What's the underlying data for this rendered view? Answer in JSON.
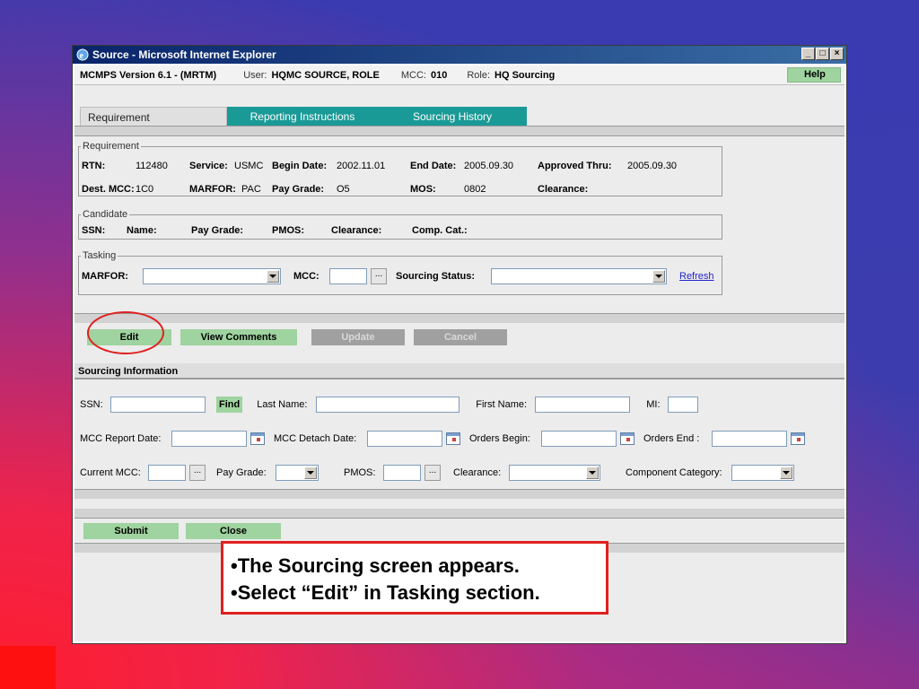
{
  "window": {
    "title": "Source - Microsoft Internet Explorer",
    "btn_min": "_",
    "btn_max": "□",
    "btn_close": "×"
  },
  "infobar": {
    "version": "MCMPS Version 6.1 - (MRTM)",
    "user_label": "User:",
    "user_value": "HQMC SOURCE, ROLE",
    "mcc_label": "MCC:",
    "mcc_value": "010",
    "role_label": "Role:",
    "role_value": "HQ Sourcing",
    "help": "Help"
  },
  "tabs": [
    {
      "label": "Requirement"
    },
    {
      "label": "Reporting Instructions"
    },
    {
      "label": "Sourcing History"
    }
  ],
  "requirement": {
    "legend": "Requirement",
    "rtn_label": "RTN:",
    "rtn_value": "112480",
    "service_label": "Service:",
    "service_value": "USMC",
    "begin_label": "Begin Date:",
    "begin_value": "2002.11.01",
    "end_label": "End Date:",
    "end_value": "2005.09.30",
    "approved_label": "Approved Thru:",
    "approved_value": "2005.09.30",
    "dest_label": "Dest. MCC:",
    "dest_value": "1C0",
    "marfor_label": "MARFOR:",
    "marfor_value": "PAC",
    "pay_label": "Pay Grade:",
    "pay_value": "O5",
    "mos_label": "MOS:",
    "mos_value": "0802",
    "clearance_label": "Clearance:"
  },
  "candidate": {
    "legend": "Candidate",
    "ssn": "SSN:",
    "name": "Name:",
    "pay": "Pay Grade:",
    "pmos": "PMOS:",
    "clearance": "Clearance:",
    "comp": "Comp. Cat.:"
  },
  "tasking": {
    "legend": "Tasking",
    "marfor": "MARFOR:",
    "mcc": "MCC:",
    "status": "Sourcing Status:",
    "refresh": "Refresh",
    "dots": "..."
  },
  "actions": {
    "edit": "Edit",
    "view_comments": "View Comments",
    "update": "Update",
    "cancel": "Cancel"
  },
  "sourcing": {
    "header": "Sourcing Information",
    "ssn": "SSN:",
    "find": "Find",
    "last_name": "Last Name:",
    "first_name": "First Name:",
    "mi": "MI:",
    "mcc_report": "MCC Report Date:",
    "mcc_detach": "MCC Detach Date:",
    "orders_begin": "Orders Begin:",
    "orders_end": "Orders End :",
    "current_mcc": "Current MCC:",
    "pay_grade": "Pay Grade:",
    "pmos": "PMOS:",
    "clearance": "Clearance:",
    "component": "Component Category:",
    "dots": "..."
  },
  "bottom": {
    "submit": "Submit",
    "close": "Close"
  },
  "callout": {
    "line1": "•The Sourcing screen appears.",
    "line2": "•Select “Edit” in Tasking section."
  }
}
